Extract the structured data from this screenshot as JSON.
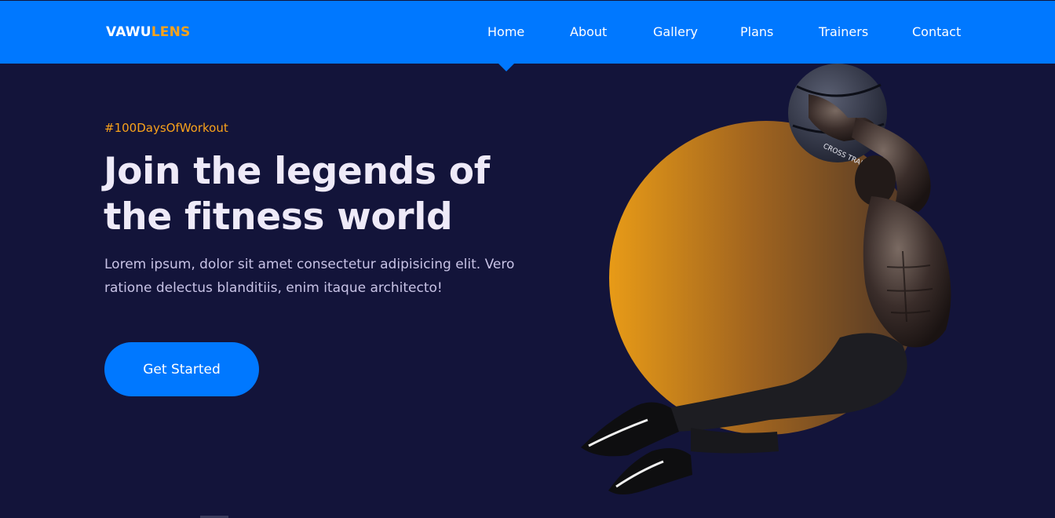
{
  "brand": {
    "logo_primary": "VAWU",
    "logo_accent": "LENS",
    "accent_color": "#f9a21b",
    "nav_color": "#0078ff",
    "background_color": "#13143a"
  },
  "nav": {
    "items": [
      {
        "label": "Home",
        "active": true
      },
      {
        "label": "About",
        "active": false
      },
      {
        "label": "Gallery",
        "active": false
      },
      {
        "label": "Plans",
        "active": false
      },
      {
        "label": "Trainers",
        "active": false
      },
      {
        "label": "Contact",
        "active": false
      }
    ]
  },
  "hero": {
    "tag": "#100DaysOfWorkout",
    "title": "Join the legends of the fitness world",
    "text": "Lorem ipsum, dolor sit amet consectetur adipisicing elit. Vero ratione delectus blanditiis, enim itaque architecto!",
    "cta_label": "Get Started",
    "image_icon": "athlete-with-medicine-ball",
    "ball_text": "CROSS TRAIN"
  }
}
